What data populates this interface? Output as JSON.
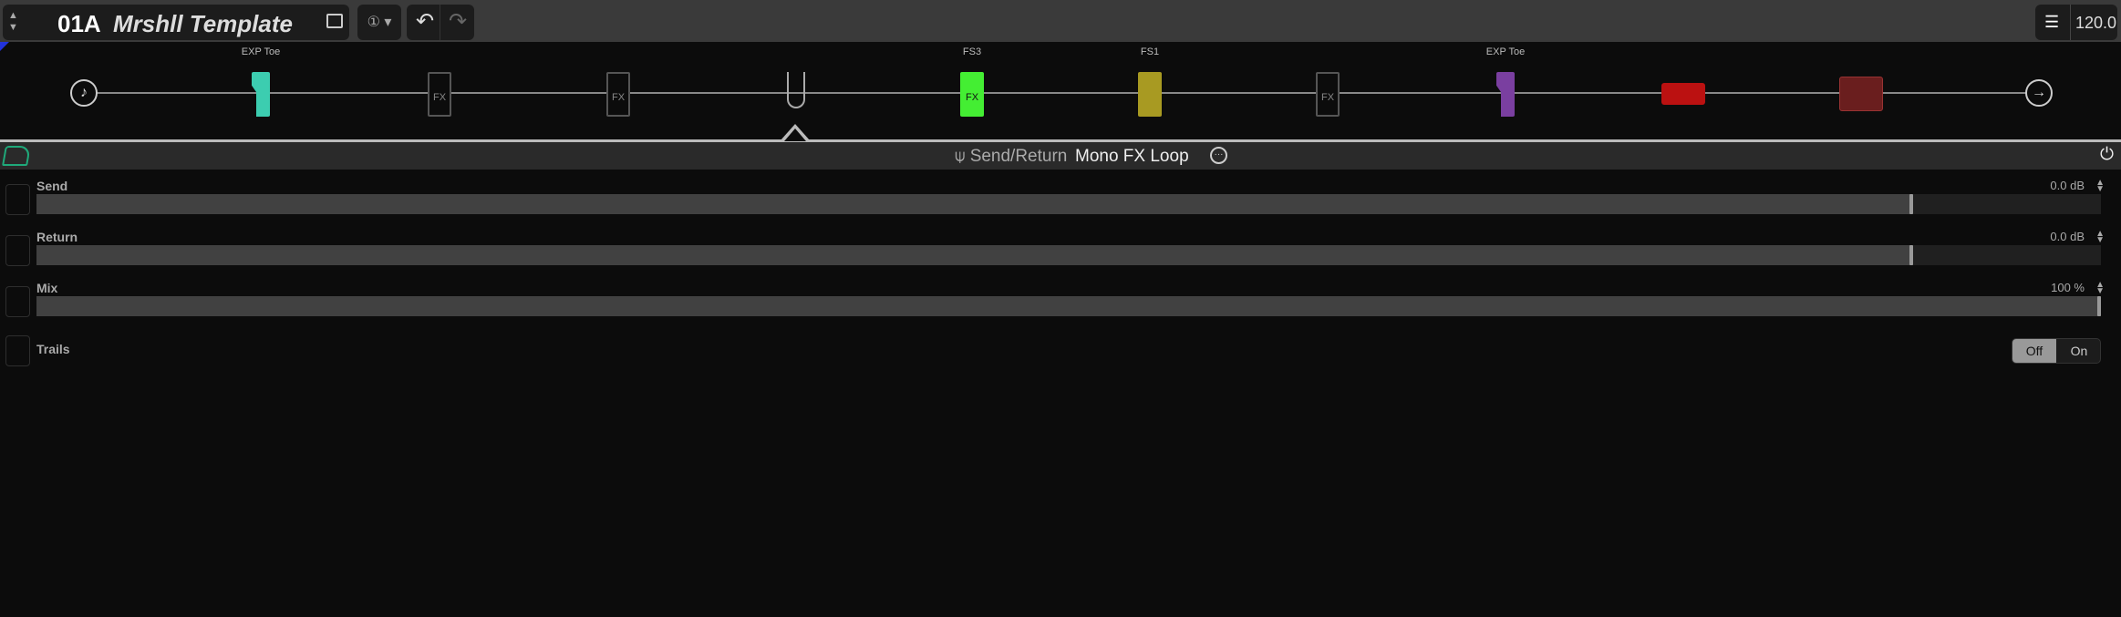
{
  "preset": {
    "number": "01A",
    "name": "Mrshll Template",
    "snapshot_label": "①"
  },
  "tempo": "120.0",
  "chain": {
    "blocks": [
      {
        "type": "input",
        "label": ""
      },
      {
        "type": "expression",
        "label": "EXP Toe",
        "color": "#3ccdb0"
      },
      {
        "type": "empty",
        "label": "",
        "text": "FX"
      },
      {
        "type": "empty",
        "label": "",
        "text": "FX"
      },
      {
        "type": "send-return",
        "label": "",
        "selected": true
      },
      {
        "type": "distortion",
        "label": "FS3",
        "color": "#44ee33",
        "text": "FX"
      },
      {
        "type": "eq",
        "label": "FS1",
        "color": "#a89a22"
      },
      {
        "type": "empty",
        "label": "",
        "text": "FX"
      },
      {
        "type": "expression",
        "label": "EXP Toe",
        "color": "#7a3fa0"
      },
      {
        "type": "amp",
        "label": "",
        "color": "#bb1111"
      },
      {
        "type": "cab",
        "label": "",
        "color": "#6a1e1e"
      },
      {
        "type": "output",
        "label": ""
      }
    ]
  },
  "block": {
    "category": "Send/Return",
    "model": "Mono FX Loop",
    "accent": "#1fa97a"
  },
  "params": [
    {
      "label": "Send",
      "value": "0.0 dB",
      "fraction": 0.909
    },
    {
      "label": "Return",
      "value": "0.0 dB",
      "fraction": 0.909
    },
    {
      "label": "Mix",
      "value": "100 %",
      "fraction": 1.0
    }
  ],
  "trails": {
    "label": "Trails",
    "off": "Off",
    "on": "On",
    "state": "Off"
  }
}
